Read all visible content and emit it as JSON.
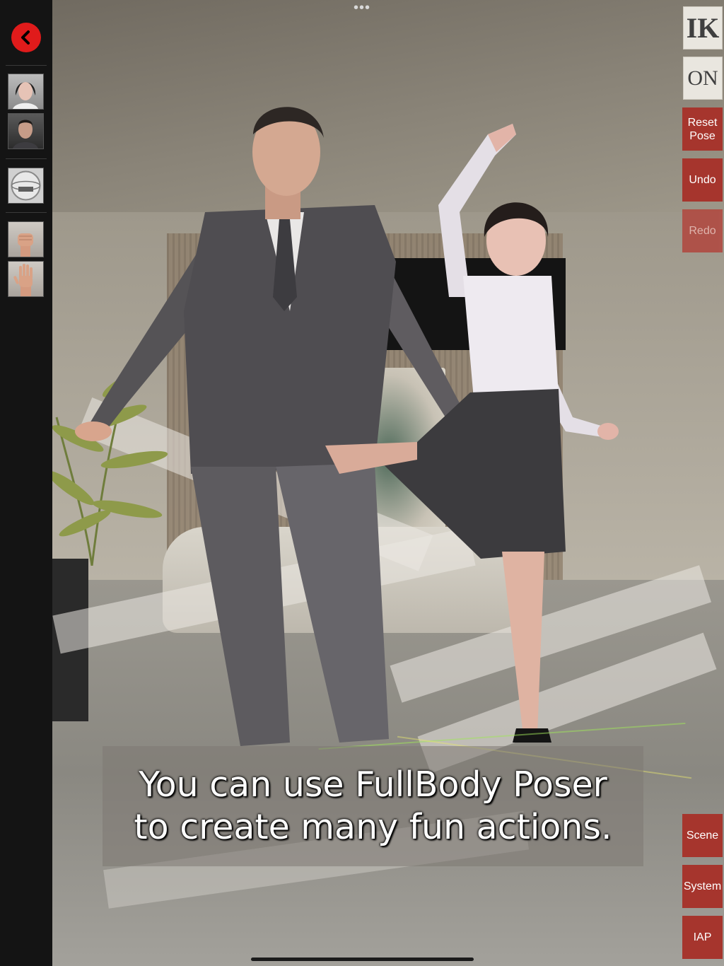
{
  "left_toolbar": {
    "back_button": {
      "icon": "chevron-left-icon",
      "color": "#e01b1b"
    },
    "thumbnails": [
      {
        "name": "female-character-thumb",
        "icon": "female-avatar-icon"
      },
      {
        "name": "male-character-thumb",
        "icon": "male-avatar-icon"
      },
      {
        "name": "environment-thumb",
        "icon": "environment-sphere-icon"
      },
      {
        "name": "fist-hand-thumb",
        "icon": "fist-hand-icon"
      },
      {
        "name": "open-hand-thumb",
        "icon": "open-hand-icon"
      }
    ]
  },
  "top_handle": "•••",
  "right_toolbar": {
    "ik_label": "IK",
    "on_label": "ON",
    "reset_pose_line1": "Reset",
    "reset_pose_line2": "Pose",
    "undo_label": "Undo",
    "redo_label": "Redo",
    "scene_label": "Scene",
    "system_label": "System",
    "iap_label": "IAP",
    "accent": "#a6352d"
  },
  "caption": {
    "line1": "You can use FullBody Poser",
    "line2": "to create many fun actions."
  }
}
